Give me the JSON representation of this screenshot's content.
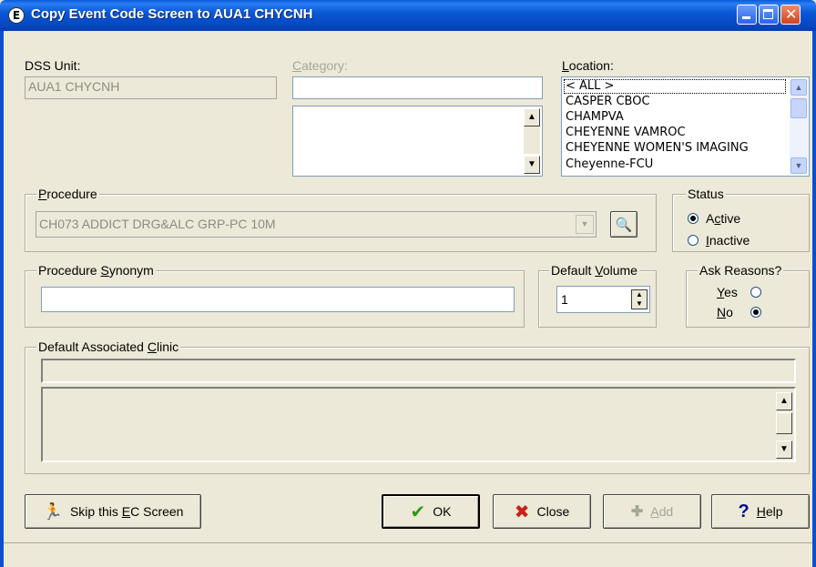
{
  "window": {
    "title": "Copy Event Code Screen to AUA1 CHYCNH",
    "icon_name": "app-icon"
  },
  "dss_unit": {
    "label": "DSS Unit:",
    "value": "AUA1 CHYCNH"
  },
  "category": {
    "label": "Category:",
    "value": ""
  },
  "location": {
    "label": "Location:",
    "items": [
      "< ALL >",
      "CASPER CBOC",
      "CHAMPVA",
      "CHEYENNE VAMROC",
      "CHEYENNE WOMEN'S IMAGING",
      "Cheyenne-FCU"
    ],
    "selected": "< ALL >"
  },
  "procedure": {
    "group_label": "Procedure",
    "value": "CH073 ADDICT DRG&ALC GRP-PC 10M"
  },
  "status": {
    "group_label": "Status",
    "options": [
      "Active",
      "Inactive"
    ],
    "selected": "Active"
  },
  "procedure_synonym": {
    "group_label": "Procedure Synonym",
    "value": ""
  },
  "default_volume": {
    "group_label": "Default Volume",
    "value": "1"
  },
  "ask_reasons": {
    "group_label": "Ask Reasons?",
    "options": [
      "Yes",
      "No"
    ],
    "selected": "No"
  },
  "default_clinic": {
    "group_label": "Default Associated Clinic",
    "value": ""
  },
  "buttons": {
    "skip": "Skip this EC Screen",
    "ok": "OK",
    "close": "Close",
    "add": "Add",
    "help": "Help"
  },
  "colors": {
    "titlebar": "#0a58d4",
    "dialog_bg": "#ece9d8",
    "ok_check": "#2e9a16",
    "close_x": "#c8201a"
  }
}
